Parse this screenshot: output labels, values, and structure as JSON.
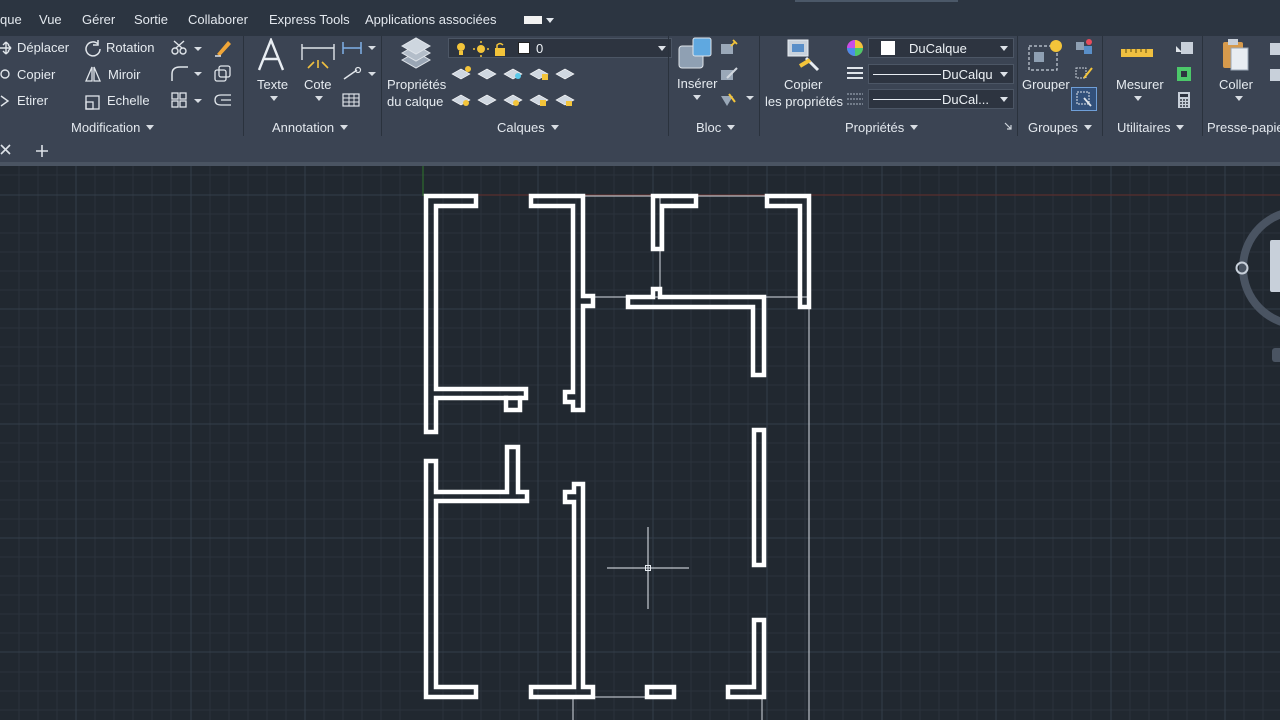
{
  "menubar": {
    "items": [
      "que",
      "Vue",
      "Gérer",
      "Sortie",
      "Collaborer",
      "Express Tools",
      "Applications associées"
    ]
  },
  "modification": {
    "title": "Modification",
    "move": "Déplacer",
    "rotate": "Rotation",
    "copy": "Copier",
    "mirror": "Miroir",
    "stretch": "Etirer",
    "scale": "Echelle"
  },
  "annotation": {
    "title": "Annotation",
    "text": "Texte",
    "dimension": "Cote"
  },
  "layers": {
    "title": "Calques",
    "properties_line1": "Propriétés",
    "properties_line2": "du calque",
    "current_layer": "0"
  },
  "block": {
    "title": "Bloc",
    "insert": "Insérer"
  },
  "properties": {
    "title": "Propriétés",
    "match_line1": "Copier",
    "match_line2": "les propriétés",
    "color": "DuCalque",
    "linetype": "DuCalqu",
    "lineweight": "DuCal..."
  },
  "groups": {
    "title": "Groupes",
    "group": "Grouper"
  },
  "utilities": {
    "title": "Utilitaires",
    "measure": "Mesurer"
  },
  "clipboard": {
    "title": "Presse-papie",
    "paste": "Coller"
  },
  "colors": {
    "background": "#212830",
    "ribbon": "#3b4453",
    "menubar": "#2c3541",
    "walls": "#ffffff"
  }
}
